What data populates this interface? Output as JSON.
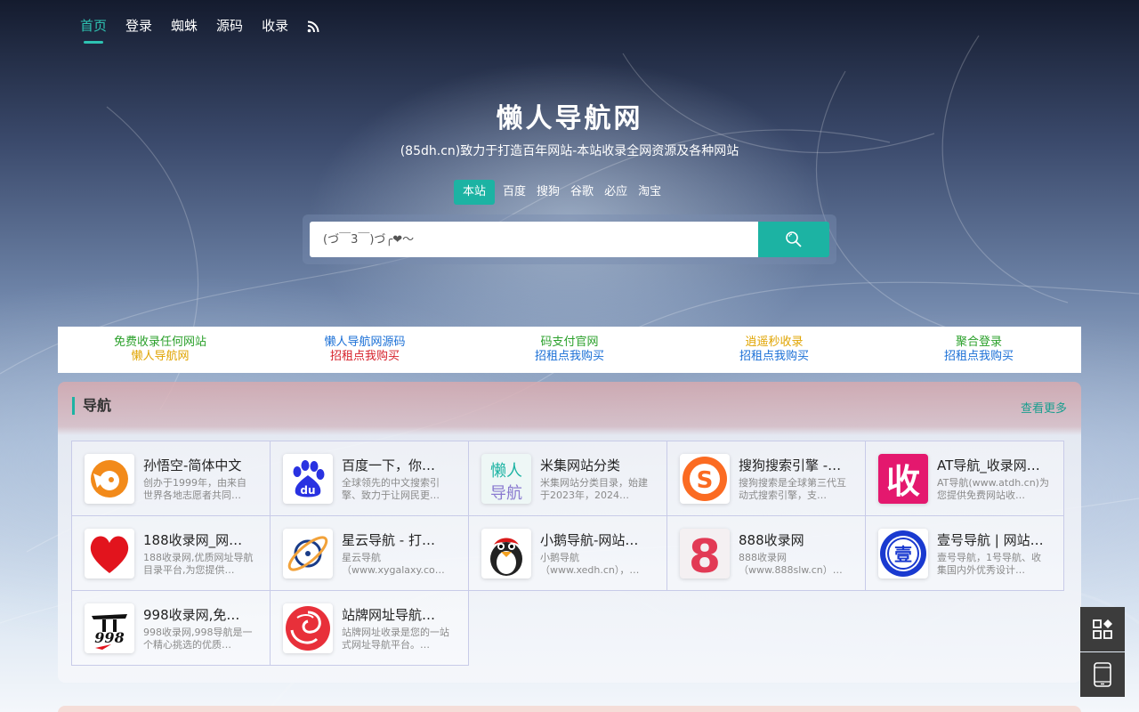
{
  "nav": {
    "items": [
      {
        "label": "首页",
        "active": true
      },
      {
        "label": "登录",
        "active": false
      },
      {
        "label": "蜘蛛",
        "active": false
      },
      {
        "label": "源码",
        "active": false
      },
      {
        "label": "收录",
        "active": false
      }
    ],
    "rss_icon": "rss-icon"
  },
  "hero": {
    "title": "懒人导航网",
    "subtitle": "(85dh.cn)致力于打造百年网站-本站收录全网资源及各种网站",
    "engines": [
      {
        "label": "本站",
        "active": true
      },
      {
        "label": "百度",
        "active": false
      },
      {
        "label": "搜狗",
        "active": false
      },
      {
        "label": "谷歌",
        "active": false
      },
      {
        "label": "必应",
        "active": false
      },
      {
        "label": "淘宝",
        "active": false
      }
    ],
    "search_placeholder": "(づ￣3￣)づ╭❤～",
    "search_icon": "search-icon"
  },
  "ads": [
    {
      "line1": "免费收录任何网站",
      "line1_color": "#2aa02a",
      "line2": "懒人导航网",
      "line2_color": "#e0a400"
    },
    {
      "line1": "懒人导航网源码",
      "line1_color": "#1a6fd6",
      "line2": "招租点我购买",
      "line2_color": "#d6202a"
    },
    {
      "line1": "码支付官网",
      "line1_color": "#2aa02a",
      "line2": "招租点我购买",
      "line2_color": "#1a6fd6"
    },
    {
      "line1": "逍遥秒收录",
      "line1_color": "#e0a400",
      "line2": "招租点我购买",
      "line2_color": "#1a6fd6"
    },
    {
      "line1": "聚合登录",
      "line1_color": "#2aa02a",
      "line2": "招租点我购买",
      "line2_color": "#1a6fd6"
    }
  ],
  "panel": {
    "title": "导航",
    "more": "查看更多",
    "sites": [
      {
        "name": "孙悟空-简体中文",
        "desc": "创办于1999年，由来自世界各地志愿者共同…",
        "logo": "sunwukong-logo"
      },
      {
        "name": "百度一下，你…",
        "desc": "全球领先的中文搜索引擎、致力于让网民更…",
        "logo": "baidu-logo"
      },
      {
        "name": "米集网站分类",
        "desc": "米集网站分类目录，始建于2023年，2024…",
        "logo": "lanren-logo",
        "logo_text_1": "懒人",
        "logo_text_2": "导航"
      },
      {
        "name": "搜狗搜索引擎 -…",
        "desc": "搜狗搜索是全球第三代互动式搜索引擎，支…",
        "logo": "sogou-logo"
      },
      {
        "name": "AT导航_收录网…",
        "desc": "AT导航(www.atdh.cn)为您提供免费网站收…",
        "logo": "shoulu-logo",
        "logo_text": "收"
      },
      {
        "name": "188收录网_网…",
        "desc": "188收录网,优质网址导航目录平台,为您提供…",
        "logo": "heart-logo"
      },
      {
        "name": "星云导航 - 打…",
        "desc": "星云导航（www.xygalaxy.co…",
        "logo": "xingyun-logo"
      },
      {
        "name": "小鹅导航-网站…",
        "desc": "小鹅导航（www.xedh.cn），…",
        "logo": "penguin-logo"
      },
      {
        "name": "888收录网",
        "desc": "888收录网（www.888slw.cn）…",
        "logo": "eight-logo",
        "logo_text": "8"
      },
      {
        "name": "壹号导航 | 网站…",
        "desc": "壹号导航，1号导航、收集国内外优秀设计…",
        "logo": "yihao-logo",
        "logo_text": "壹"
      },
      {
        "name": "998收录网,免…",
        "desc": "998收录网,998导航是一个精心挑选的优质…",
        "logo": "998-logo",
        "logo_text": "998"
      },
      {
        "name": "站牌网址导航…",
        "desc": "站牌网址收录是您的一站式网址导航平台。…",
        "logo": "spiral-logo"
      }
    ]
  },
  "side_buttons": [
    "apps-icon",
    "tablet-icon"
  ]
}
